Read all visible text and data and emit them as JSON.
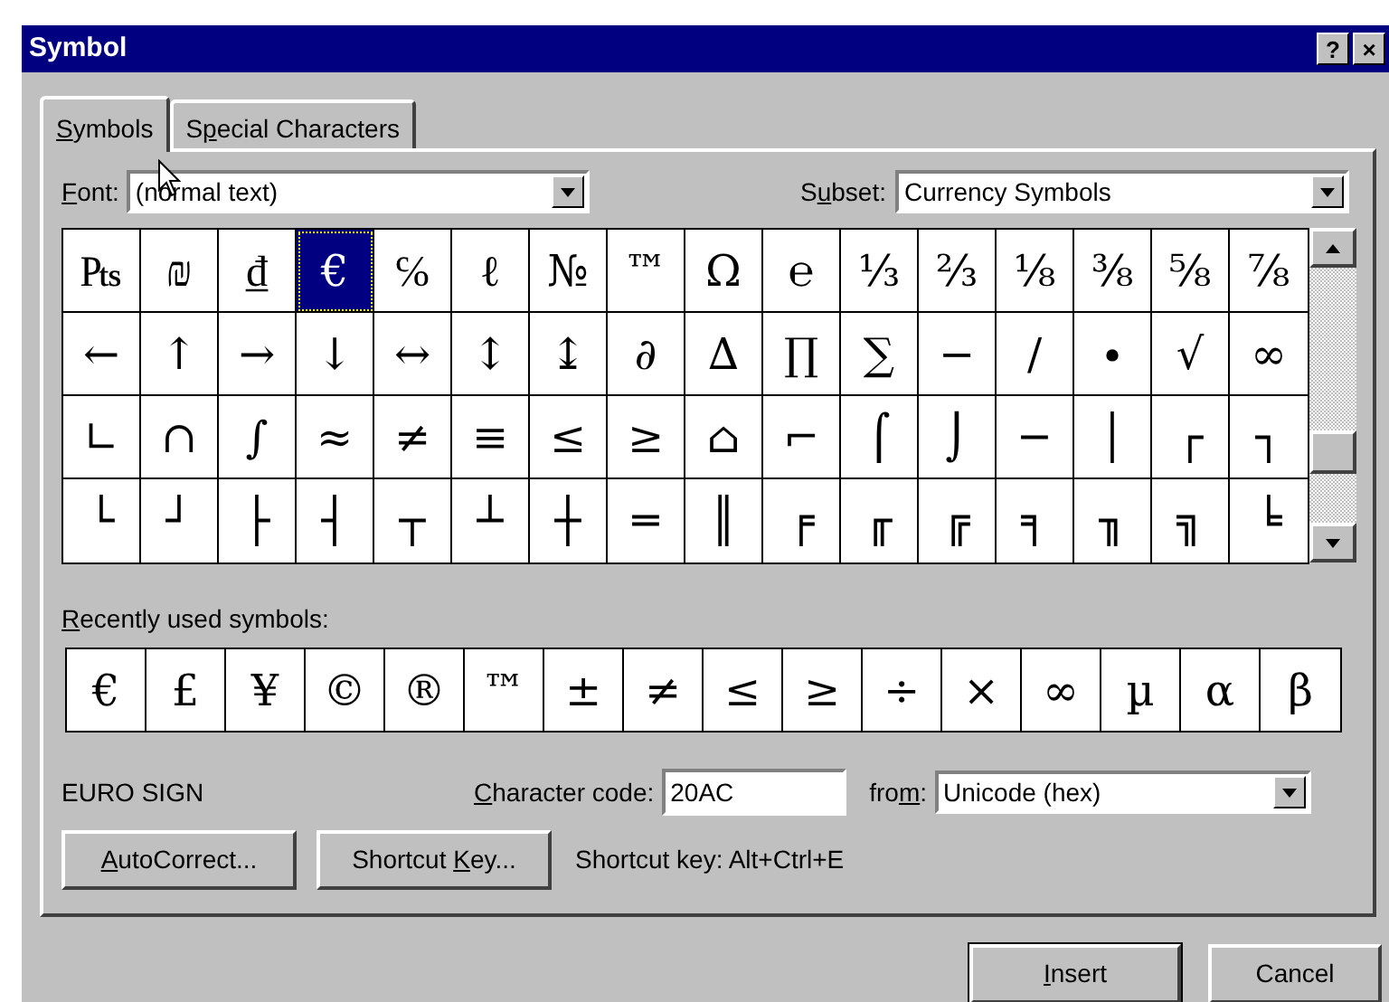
{
  "window": {
    "title": "Symbol",
    "buttons": [
      "?",
      "×"
    ]
  },
  "tabs": [
    {
      "label": {
        "key": "S",
        "post": "ymbols"
      },
      "selected": true
    },
    {
      "label": {
        "pre": "S",
        "key": "p",
        "post": "ecial Characters"
      },
      "selected": false
    }
  ],
  "font": {
    "label": {
      "key": "F",
      "post": "ont:"
    },
    "value": "(normal text)"
  },
  "subset": {
    "label": {
      "pre": "S",
      "key": "u",
      "post": "bset:"
    },
    "value": "Currency Symbols"
  },
  "symbol_grid": [
    [
      {
        "char": "₧",
        "selected": false
      },
      {
        "char": "₪",
        "selected": false
      },
      {
        "char": "₫",
        "selected": false
      },
      {
        "char": "€",
        "selected": true
      },
      {
        "char": "℅",
        "selected": false
      },
      {
        "char": "ℓ",
        "selected": false
      },
      {
        "char": "№",
        "selected": false
      },
      {
        "char": "™",
        "selected": false
      },
      {
        "char": "Ω",
        "selected": false
      },
      {
        "char": "℮",
        "selected": false
      },
      {
        "char": "⅓",
        "selected": false
      },
      {
        "char": "⅔",
        "selected": false
      },
      {
        "char": "⅛",
        "selected": false
      },
      {
        "char": "⅜",
        "selected": false
      },
      {
        "char": "⅝",
        "selected": false
      },
      {
        "char": "⅞",
        "selected": false
      }
    ],
    [
      {
        "char": "←",
        "selected": false
      },
      {
        "char": "↑",
        "selected": false
      },
      {
        "char": "→",
        "selected": false
      },
      {
        "char": "↓",
        "selected": false
      },
      {
        "char": "↔",
        "selected": false
      },
      {
        "char": "↕",
        "selected": false
      },
      {
        "char": "↨",
        "selected": false
      },
      {
        "char": "∂",
        "selected": false
      },
      {
        "char": "∆",
        "selected": false
      },
      {
        "char": "∏",
        "selected": false
      },
      {
        "char": "∑",
        "selected": false
      },
      {
        "char": "−",
        "selected": false
      },
      {
        "char": "∕",
        "selected": false
      },
      {
        "char": "∙",
        "selected": false
      },
      {
        "char": "√",
        "selected": false
      },
      {
        "char": "∞",
        "selected": false
      }
    ],
    [
      {
        "char": "∟",
        "selected": false
      },
      {
        "char": "∩",
        "selected": false
      },
      {
        "char": "∫",
        "selected": false
      },
      {
        "char": "≈",
        "selected": false
      },
      {
        "char": "≠",
        "selected": false
      },
      {
        "char": "≡",
        "selected": false
      },
      {
        "char": "≤",
        "selected": false
      },
      {
        "char": "≥",
        "selected": false
      },
      {
        "char": "⌂",
        "selected": false
      },
      {
        "char": "⌐",
        "selected": false
      },
      {
        "char": "⌠",
        "selected": false
      },
      {
        "char": "⌡",
        "selected": false
      },
      {
        "char": "─",
        "selected": false
      },
      {
        "char": "│",
        "selected": false
      },
      {
        "char": "┌",
        "selected": false
      },
      {
        "char": "┐",
        "selected": false
      }
    ],
    [
      {
        "char": "└",
        "selected": false
      },
      {
        "char": "┘",
        "selected": false
      },
      {
        "char": "├",
        "selected": false
      },
      {
        "char": "┤",
        "selected": false
      },
      {
        "char": "┬",
        "selected": false
      },
      {
        "char": "┴",
        "selected": false
      },
      {
        "char": "┼",
        "selected": false
      },
      {
        "char": "═",
        "selected": false
      },
      {
        "char": "║",
        "selected": false
      },
      {
        "char": "╒",
        "selected": false
      },
      {
        "char": "╓",
        "selected": false
      },
      {
        "char": "╔",
        "selected": false
      },
      {
        "char": "╕",
        "selected": false
      },
      {
        "char": "╖",
        "selected": false
      },
      {
        "char": "╗",
        "selected": false
      },
      {
        "char": "╘",
        "selected": false
      }
    ]
  ],
  "recent": {
    "label": {
      "key": "R",
      "post": "ecently used symbols:"
    },
    "symbols": [
      "€",
      "£",
      "¥",
      "©",
      "®",
      "™",
      "±",
      "≠",
      "≤",
      "≥",
      "÷",
      "×",
      "∞",
      "µ",
      "α",
      "β"
    ]
  },
  "character_name": "EURO SIGN",
  "character_code": {
    "label": {
      "key": "C",
      "post": "haracter code:"
    },
    "value": "20AC"
  },
  "from": {
    "label": {
      "pre": "fro",
      "key": "m",
      "post": ":"
    },
    "value": "Unicode (hex)"
  },
  "buttons": [
    {
      "label": {
        "key": "A",
        "post": "utoCorrect..."
      }
    },
    {
      "label": {
        "pre": "Shortcut ",
        "key": "K",
        "post": "ey..."
      }
    }
  ],
  "shortcut_text": "Shortcut key: Alt+Ctrl+E",
  "dialog_buttons": [
    {
      "label": {
        "key": "I",
        "post": "nsert"
      },
      "default": true
    },
    {
      "label": {
        "pre": "Cancel"
      },
      "default": false
    }
  ]
}
